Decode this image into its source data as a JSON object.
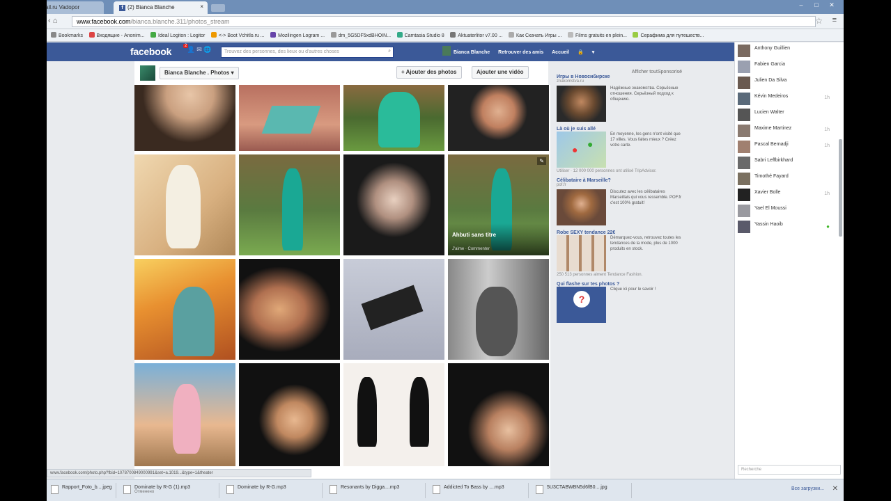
{
  "browser": {
    "tab1_title": "ail.ru Vadopor",
    "tab2_title": "(2) Bianca Blanche",
    "url_domain": "www.facebook.com",
    "url_path": "/bianca.blanche.311/photos_stream",
    "bookmarks": [
      "Bookmarks",
      "Входящие - Anonim...",
      "Ideal Logiton : Logitor",
      "<-> Boot Vchitlo.ru ...",
      "Mozilingen Logram ...",
      "dm_5G5DF5xdBHOIN...",
      "Camtasia Studio 8",
      "Aktuaterlitor v7.00 ...",
      "Как Скачать Игры ...",
      "Films gratuits en plein...",
      "Серафима для путешеств..."
    ],
    "status_url": "www.facebook.com/photo.php?fbid=1078700849000991&set=a.1019...&type=1&theater"
  },
  "facebook": {
    "logo": "facebook",
    "notif_count": "2",
    "search_placeholder": "Trouvez des personnes, des lieux ou d'autres choses",
    "user_name": "Bianca Blanche",
    "find_friends": "Retrouver des amis",
    "home": "Accueil"
  },
  "album": {
    "selector_label": "Bianca Blanche . Photos ▾",
    "add_photos": "+ Ajouter des photos",
    "add_video": "Ajouter une vidéo"
  },
  "photo_overlay": {
    "title": "Ahbuti sans titre",
    "actions": "J'aime · Commenter"
  },
  "ads": {
    "sponsored": "Sponsorisé",
    "create_ad": "Afficher tout",
    "items": [
      {
        "title": "Игры в Новосибирске",
        "domain": "znakomstva.ru",
        "text": "Надёжные знакомства. Серьёзные отношения. Серьёзный подход к общению.",
        "footer": ""
      },
      {
        "title": "Là où je suis allé",
        "domain": "",
        "text": "En moyenne, les gens n'ont visité que 17 villes. Vous faites mieux ? Créez votre carte.",
        "footer": "Utiliser · 12 000 000 personnes ont utilisé TripAdvisor."
      },
      {
        "title": "Célibataire à Marseille?",
        "domain": "pof.fr",
        "text": "Discutez avec les célibataires Marseillais qui vous ressemble. POF.fr c'est 100% gratuit!",
        "footer": ""
      },
      {
        "title": "Robe SEXY tendance 22€",
        "domain": "",
        "text": "Démarquez-vous, retrouvez toutes les tendances de la mode, plus de 1000 produits en stock.",
        "footer": "250 513 personnes aiment Tendance Fashion."
      },
      {
        "title": "Qui flashe sur tes photos ?",
        "domain": "",
        "text": "Clique ici pour le savoir !",
        "footer": ""
      }
    ]
  },
  "chat": {
    "friends": [
      {
        "name": "Anthony Guillien",
        "status": ""
      },
      {
        "name": "Fabien Garcia",
        "status": ""
      },
      {
        "name": "Julien Da Silva",
        "status": ""
      },
      {
        "name": "Kévin Medeiros",
        "status": "1h"
      },
      {
        "name": "Lucien Walter",
        "status": ""
      },
      {
        "name": "Maxime Martinez",
        "status": "1h"
      },
      {
        "name": "Pascal Bernadji",
        "status": "1h"
      },
      {
        "name": "Sabri Leffbirkhard",
        "status": ""
      },
      {
        "name": "Timothé Fayard",
        "status": ""
      },
      {
        "name": "Xavier Bolle",
        "status": "1h"
      },
      {
        "name": "Yael El Moussi",
        "status": ""
      },
      {
        "name": "Yassin Haoib",
        "status": "online"
      }
    ],
    "search_placeholder": "Recherche"
  },
  "downloads": {
    "items": [
      {
        "name": "Rapport_Foto_b....jpeg",
        "sub": ""
      },
      {
        "name": "Dominate by R-G (1).mp3",
        "sub": "Отменено"
      },
      {
        "name": "Dominate by R-G.mp3",
        "sub": ""
      },
      {
        "name": "Resonants by Digga....mp3",
        "sub": ""
      },
      {
        "name": "Addicted To Bass by ....mp3",
        "sub": ""
      },
      {
        "name": "5U3CTABWBN5d6fB0....jpg",
        "sub": ""
      }
    ],
    "show_all": "Все загрузки..."
  },
  "colors": {
    "fb_blue": "#3b5998",
    "page_bg": "#e9ebee",
    "online_green": "#42b72a"
  }
}
